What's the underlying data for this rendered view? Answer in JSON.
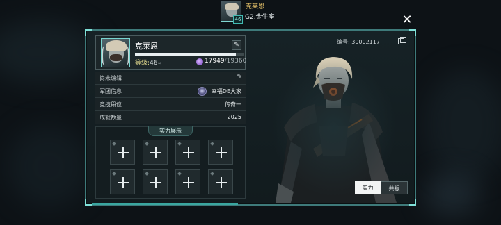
{
  "header": {
    "name": "克莱恩",
    "level_badge": "46",
    "subtitle": "G2.金牛座"
  },
  "profile": {
    "name": "克莱恩",
    "level_label": "等级:",
    "level_value": "46",
    "level_suffix": "∞",
    "exp_current": "17949",
    "exp_max": "/19360",
    "exp_progress": 0.927
  },
  "info": {
    "bio": "尚未编辑",
    "guild_label": "军团信息",
    "guild_value": "幸福DE大家",
    "rank_label": "竞技段位",
    "rank_value": "传奇一",
    "achievement_label": "成就数量",
    "achievement_value": "2025"
  },
  "showcase": {
    "title": "实力展示",
    "slot_count": 8
  },
  "uid": "编号: 30002117",
  "tabs": [
    {
      "label": "实力",
      "active": true
    },
    {
      "label": "共振",
      "active": false
    }
  ],
  "colors": {
    "accent": "#3e7a7a",
    "gold": "#e8c46a",
    "exp": "#6f3fb8"
  },
  "icons": [
    "close-icon",
    "edit-icon",
    "copy-icon",
    "plus-icon",
    "guild-emblem-icon",
    "exp-orb-icon"
  ]
}
